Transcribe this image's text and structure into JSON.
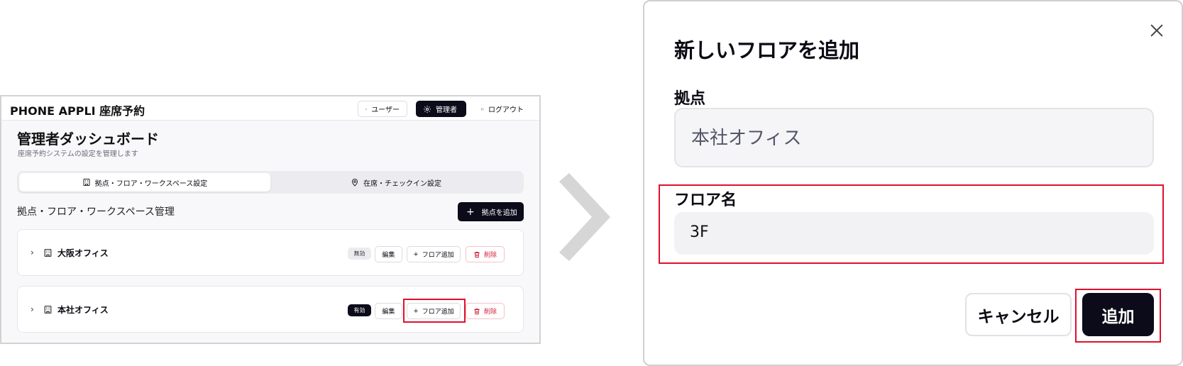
{
  "app": {
    "title": "PHONE APPLI 座席予約",
    "header": {
      "user_label": "ユーザー",
      "admin_label": "管理者",
      "logout_label": "ログアウト"
    },
    "dashboard": {
      "title": "管理者ダッシュボード",
      "subtitle": "座席予約システムの設定を管理します"
    },
    "tabs": [
      {
        "label": "拠点・フロア・ワークスペース設定",
        "icon": "building-icon",
        "active": true
      },
      {
        "label": "在席・チェックイン設定",
        "icon": "map-pin-icon",
        "active": false
      }
    ],
    "section": {
      "title": "拠点・フロア・ワークスペース管理",
      "add_site_label": "拠点を追加"
    },
    "sites": [
      {
        "name": "大阪オフィス",
        "status": "無効",
        "edit_label": "編集",
        "add_floor_label": "フロア追加",
        "delete_label": "削除"
      },
      {
        "name": "本社オフィス",
        "status": "有効",
        "edit_label": "編集",
        "add_floor_label": "フロア追加",
        "delete_label": "削除"
      }
    ]
  },
  "modal": {
    "title": "新しいフロアを追加",
    "site_label": "拠点",
    "site_value": "本社オフィス",
    "floor_label": "フロア名",
    "floor_value": "3F",
    "cancel_label": "キャンセル",
    "add_label": "追加"
  },
  "colors": {
    "primary": "#0b0b1a",
    "highlight": "#e0102d",
    "danger": "#d4213a",
    "arrow": "#d6d6d6"
  }
}
